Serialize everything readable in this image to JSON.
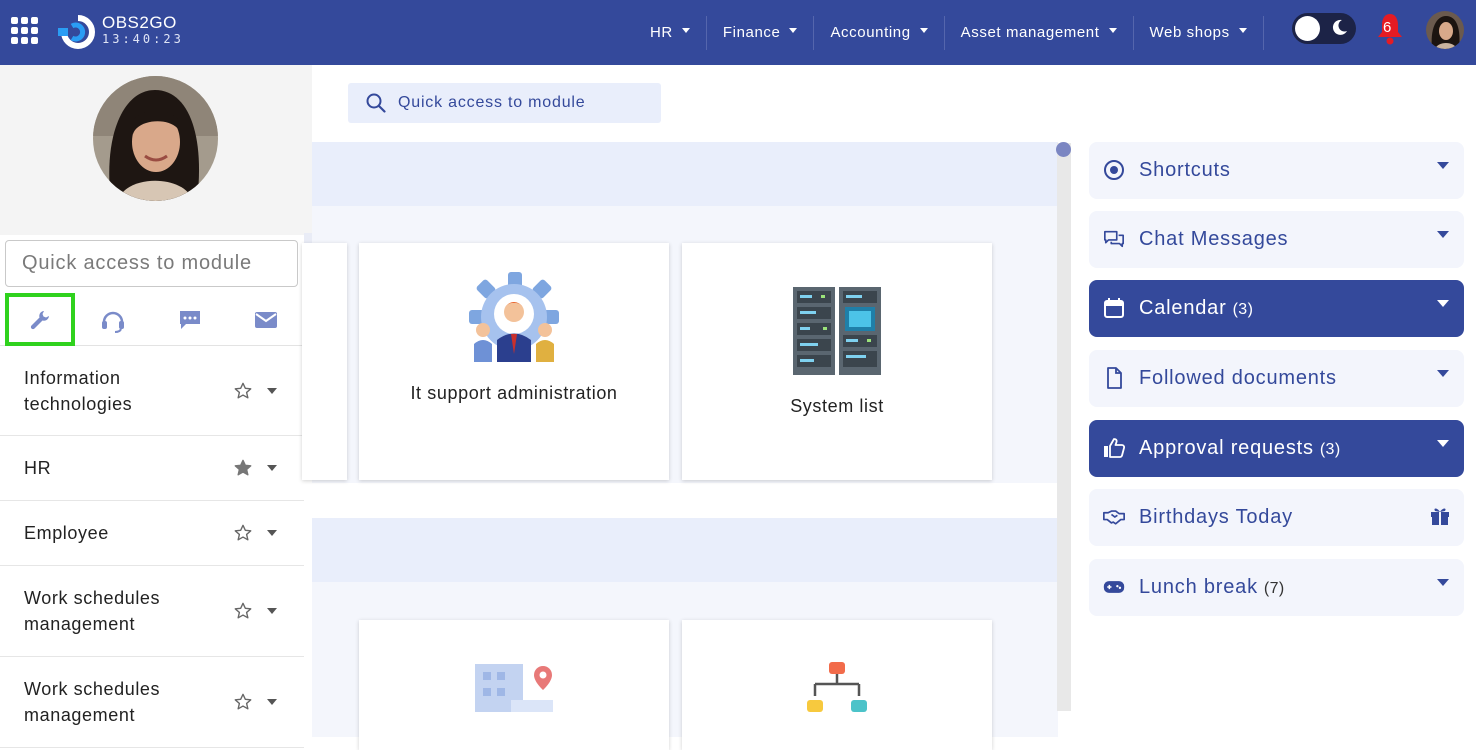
{
  "app": {
    "brand": "OBS2GO",
    "clock": "13:40:23"
  },
  "topnav": {
    "items": [
      {
        "label": "HR"
      },
      {
        "label": "Finance"
      },
      {
        "label": "Accounting"
      },
      {
        "label": "Asset management"
      },
      {
        "label": "Web shops"
      }
    ],
    "notifications_count": "6"
  },
  "sidebar": {
    "search_placeholder": "Quick access to module",
    "tabs": [
      {
        "icon": "wrench-icon",
        "active": true
      },
      {
        "icon": "headset-icon",
        "active": false
      },
      {
        "icon": "chat-bubble-icon",
        "active": false
      },
      {
        "icon": "envelope-icon",
        "active": false
      }
    ],
    "items": [
      {
        "label": "Information technologies",
        "starred": false
      },
      {
        "label": "HR",
        "starred": true
      },
      {
        "label": "Employee",
        "starred": false
      },
      {
        "label": "Work schedules management",
        "starred": false
      },
      {
        "label": "Work schedules management",
        "starred": false
      }
    ]
  },
  "main": {
    "search_placeholder": "Quick access to module",
    "cards": [
      {
        "label": "It support administration",
        "icon": "it-support-gear-icon"
      },
      {
        "label": "System list",
        "icon": "server-rack-icon"
      },
      {
        "label": "",
        "icon": "building-location-icon"
      },
      {
        "label": "",
        "icon": "org-chart-icon"
      }
    ]
  },
  "right_panels": [
    {
      "label": "Shortcuts",
      "count": "",
      "icon": "target-icon",
      "active": false
    },
    {
      "label": "Chat Messages",
      "count": "",
      "icon": "chat-icon",
      "active": false
    },
    {
      "label": "Calendar",
      "count": "(3)",
      "icon": "calendar-icon",
      "active": true
    },
    {
      "label": "Followed documents",
      "count": "",
      "icon": "document-icon",
      "active": false
    },
    {
      "label": "Approval requests",
      "count": "(3)",
      "icon": "thumbs-up-icon",
      "active": true
    },
    {
      "label": "Birthdays Today",
      "count": "",
      "icon": "handshake-icon",
      "active": false
    },
    {
      "label": "Lunch break",
      "count": "(7)",
      "icon": "gamepad-icon",
      "active": false
    }
  ],
  "colors": {
    "primary": "#34499b",
    "highlight": "#2fd21d",
    "notification": "#e51b23"
  }
}
